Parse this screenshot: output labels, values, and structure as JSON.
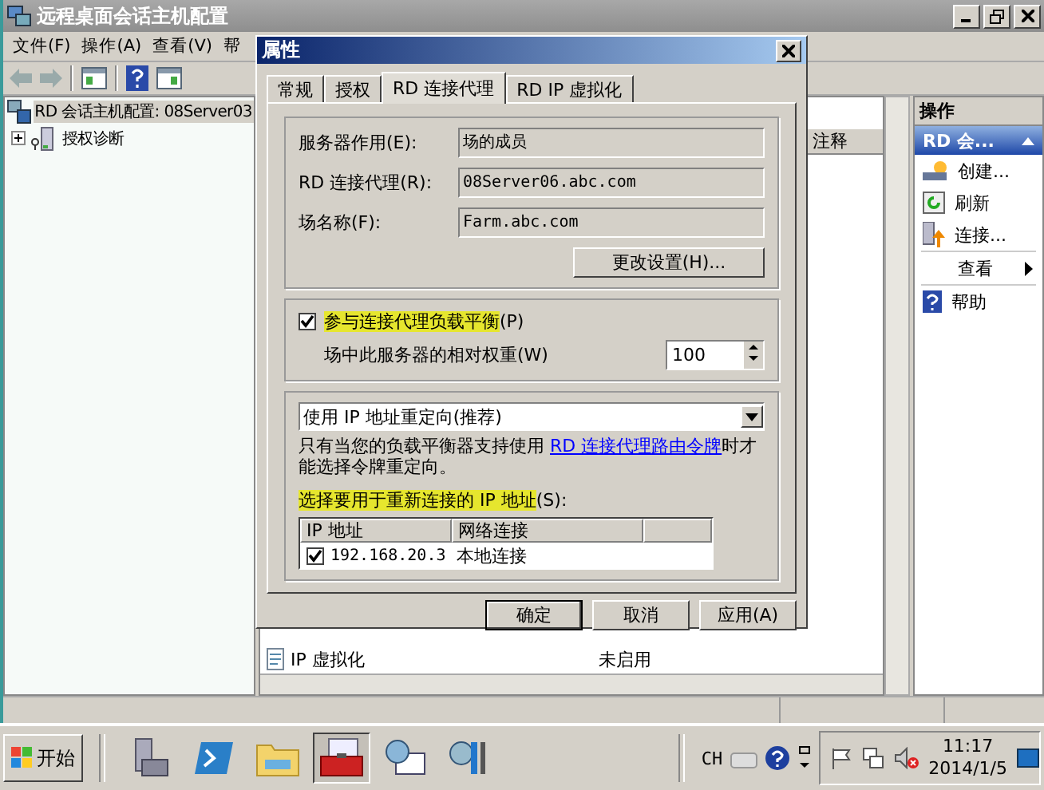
{
  "window": {
    "title": "远程桌面会话主机配置"
  },
  "menu": [
    "文件(F)",
    "操作(A)",
    "查看(V)",
    "帮"
  ],
  "tree": [
    {
      "label": "RD 会话主机配置: 08Server03",
      "selected": true,
      "kind": "host"
    },
    {
      "label": "授权诊断",
      "selected": false,
      "kind": "diag",
      "expanded": false
    }
  ],
  "middle": {
    "column": "注释",
    "rows": [
      {
        "name": "IP 虚拟化",
        "status": "未启用"
      }
    ]
  },
  "actions": {
    "title": "操作",
    "section": "RD 会...",
    "items": [
      {
        "label": "创建...",
        "kind": "create"
      },
      {
        "label": "刷新",
        "kind": "refresh"
      },
      {
        "label": "连接...",
        "kind": "connect"
      },
      {
        "label": "查看",
        "kind": "submenu"
      },
      {
        "label": "帮助",
        "kind": "help"
      }
    ]
  },
  "dialog": {
    "title": "属性",
    "tabs": [
      {
        "label": "常规",
        "selected": false
      },
      {
        "label": "授权",
        "selected": false
      },
      {
        "label": "RD 连接代理",
        "selected": true
      },
      {
        "label": "RD IP 虚拟化",
        "selected": false
      }
    ],
    "fields": [
      {
        "label": "服务器作用(E):",
        "value": "场的成员"
      },
      {
        "label": "RD 连接代理(R):",
        "value": "08Server06.abc.com"
      },
      {
        "label": "场名称(F):",
        "value": "Farm.abc.com"
      }
    ],
    "change_button": "更改设置(H)...",
    "load_balance": {
      "label": "参与连接代理负载平衡",
      "hotkey": "(P)",
      "checked": true
    },
    "weight": {
      "label": "场中此服务器的相对权重(W)",
      "value": "100"
    },
    "redirect": "使用 IP 地址重定向(推荐)",
    "note_before": "只有当您的负载平衡器支持使用 ",
    "note_link": "RD 连接代理路由令牌",
    "note_after": "时才能选择令牌重定向。",
    "ip_label": "选择要用于重新连接的 IP 地址",
    "ip_hotkey": "(S):",
    "ip_columns": [
      "IP 地址",
      "网络连接"
    ],
    "ip_rows": [
      {
        "checked": true,
        "ip": "192.168.20.3",
        "connection": "本地连接"
      }
    ],
    "buttons": [
      "确定",
      "取消",
      "应用(A)"
    ]
  },
  "taskbar": {
    "start": "开始",
    "apps": [
      {
        "kind": "server",
        "selected": false
      },
      {
        "kind": "shell",
        "selected": false
      },
      {
        "kind": "folder",
        "selected": false
      },
      {
        "kind": "toolbox",
        "selected": true
      },
      {
        "kind": "monitor",
        "selected": false
      },
      {
        "kind": "tools",
        "selected": false
      }
    ],
    "lang": "CH",
    "time": "11:17",
    "date": "2014/1/5"
  }
}
